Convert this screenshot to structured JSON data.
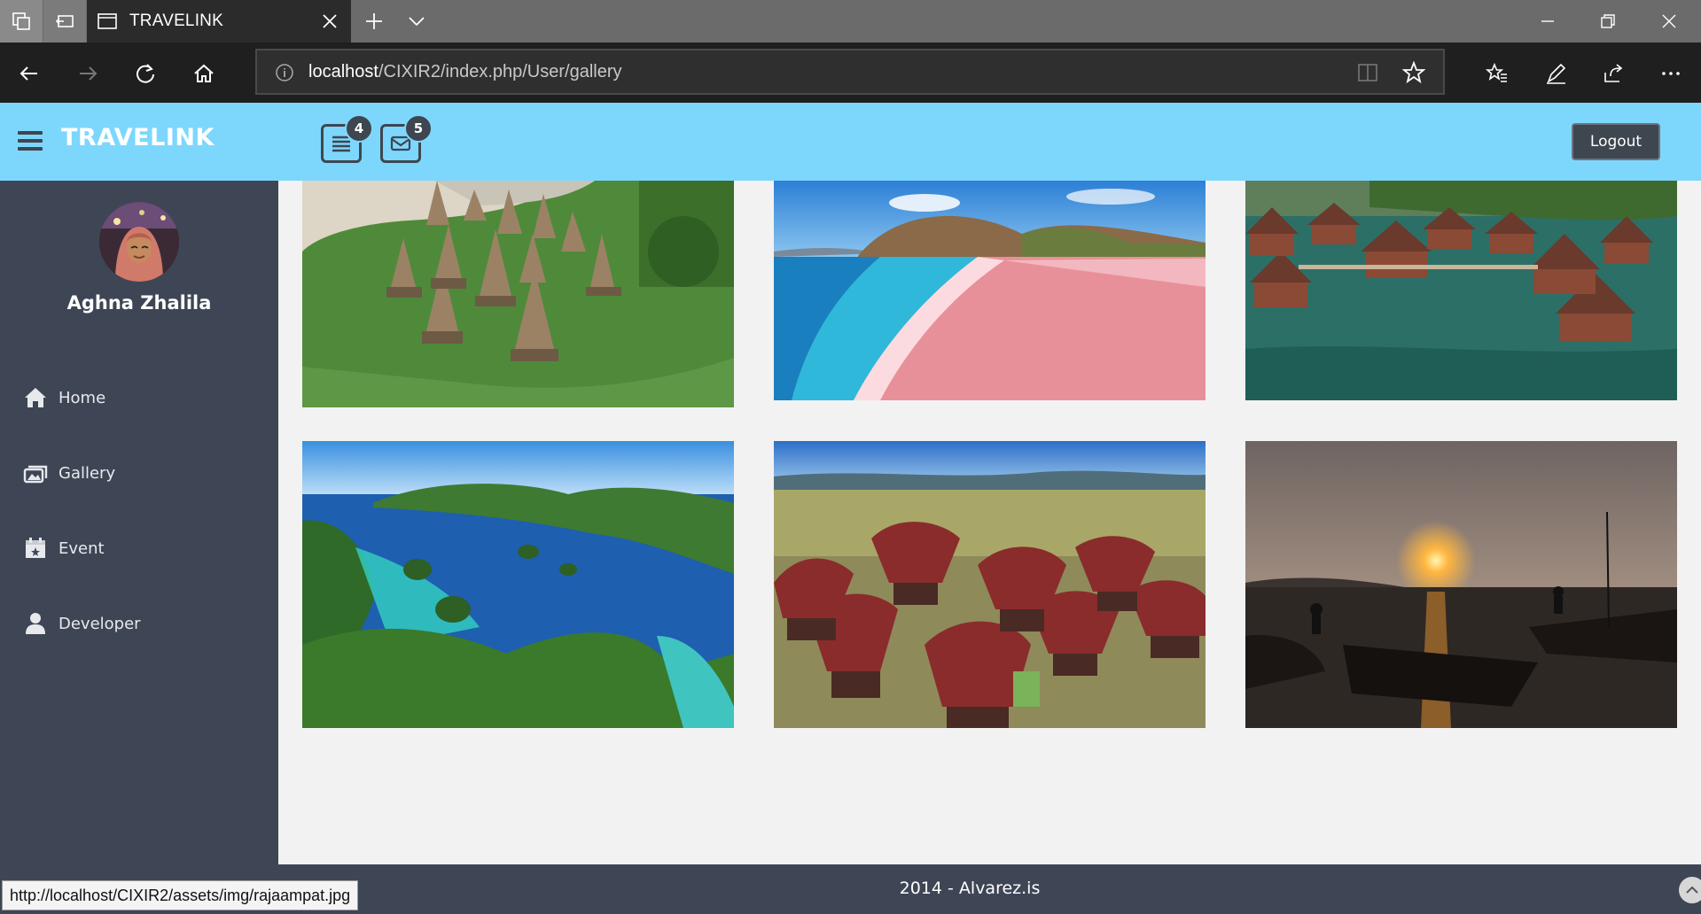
{
  "browser": {
    "tab_title": "TRAVELINK",
    "address_host": "localhost",
    "address_path": "/CIXIR2/index.php/User/gallery",
    "status_url": "http://localhost/CIXIR2/assets/img/rajaampat.jpg"
  },
  "header": {
    "brand": "TRAVELINK",
    "task_count": "4",
    "message_count": "5",
    "logout_label": "Logout",
    "bg_color": "#7dd7fd"
  },
  "sidebar": {
    "username": "Aghna Zhalila",
    "items": [
      {
        "label": "Home",
        "icon": "home-icon"
      },
      {
        "label": "Gallery",
        "icon": "gallery-icon"
      },
      {
        "label": "Event",
        "icon": "calendar-icon"
      },
      {
        "label": "Developer",
        "icon": "user-icon"
      }
    ]
  },
  "gallery": {
    "images": [
      {
        "subject": "traditional thatched houses"
      },
      {
        "subject": "pink beach"
      },
      {
        "subject": "over-water bungalows"
      },
      {
        "subject": "raja ampat islands"
      },
      {
        "subject": "toraja village"
      },
      {
        "subject": "sunset boats"
      }
    ]
  },
  "footer": {
    "text": "2014 - Alvarez.is"
  }
}
